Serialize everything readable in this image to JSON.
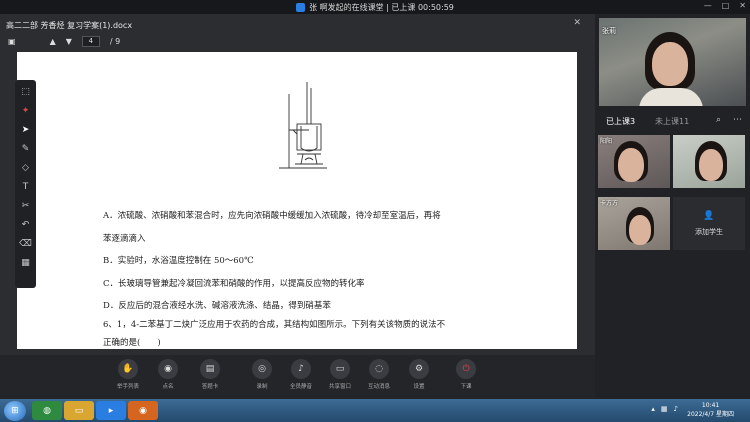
{
  "titlebar": {
    "text": "张 啊发起的在线课堂 | 已上课 00:50:59"
  },
  "window_controls": [
    "—",
    "□",
    "✕"
  ],
  "doc": {
    "title": "高二二部 芳香烃 复习学案(1).docx",
    "close": "✕",
    "page_current": "4",
    "page_total": "/ 9",
    "lines": [
      "A．浓硫酸、浓硝酸和苯混合时，应先向浓硝酸中缓缓加入浓硫酸，待冷却至室温后，再将",
      "苯逐滴滴入",
      "B．实验时，水浴温度控制在 50～60℃",
      "C．长玻璃导管兼起冷凝回流苯和硝酸的作用，以提高反应物的转化率",
      "D．反应后的混合液经水洗、碱溶液洗涤、结晶，得到硝基苯",
      "6、1，4-二苯基丁二炔广泛应用于农药的合成，其结构如图所示。下列有关该物质的说法不",
      "正确的是(　　)"
    ]
  },
  "bottom_buttons": [
    {
      "icon": "✋",
      "label": "举手列表"
    },
    {
      "icon": "◉",
      "label": "点名"
    },
    {
      "icon": "▤",
      "label": "答题卡"
    },
    {
      "icon": "◎",
      "label": "录制"
    },
    {
      "icon": "♪",
      "label": "全员静音"
    },
    {
      "icon": "▭",
      "label": "共享窗口"
    },
    {
      "icon": "◌",
      "label": "互动消息"
    },
    {
      "icon": "⚙",
      "label": "设置"
    },
    {
      "icon": "⏻",
      "label": "下课"
    }
  ],
  "right": {
    "teacher_name": "张莉",
    "tab_on": "已上课3",
    "tab_off": "未上课11",
    "students": [
      "阳阳",
      "",
      "卡方方"
    ],
    "add_student": "添加学生"
  },
  "taskbar": {
    "time": "10:41",
    "date": "2022/4/7 星期四"
  }
}
